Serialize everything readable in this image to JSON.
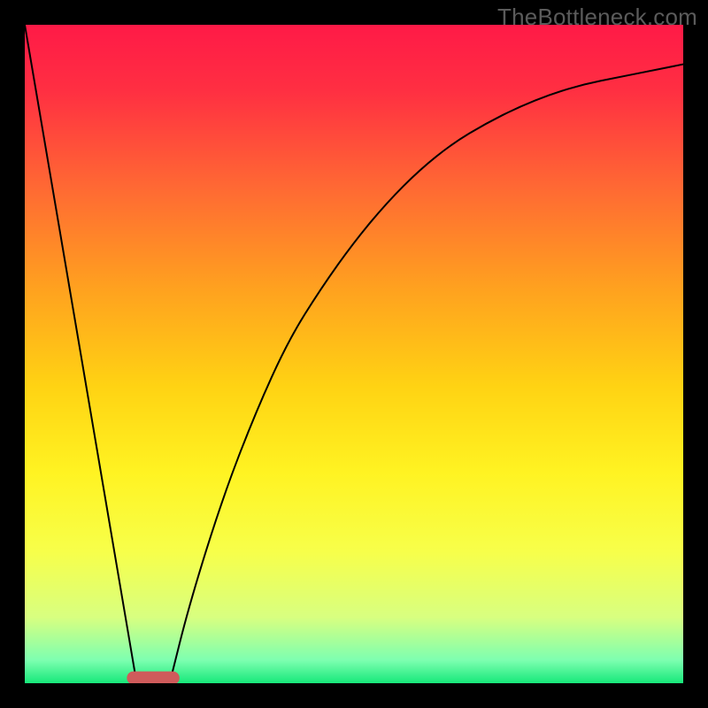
{
  "watermark": "TheBottleneck.com",
  "chart_data": {
    "type": "line",
    "title": "",
    "xlabel": "",
    "ylabel": "",
    "xlim": [
      0,
      100
    ],
    "ylim": [
      0,
      100
    ],
    "grid": false,
    "legend": false,
    "series": [
      {
        "name": "left-falling-line",
        "x": [
          0,
          17
        ],
        "values": [
          100,
          0
        ]
      },
      {
        "name": "right-rising-curve",
        "x": [
          22,
          25,
          30,
          35,
          40,
          45,
          50,
          55,
          60,
          65,
          70,
          75,
          80,
          85,
          90,
          95,
          100
        ],
        "values": [
          0,
          12,
          28,
          41,
          52,
          60,
          67,
          73,
          78,
          82,
          85,
          87.5,
          89.5,
          91,
          92,
          93,
          94
        ]
      }
    ],
    "marker": {
      "name": "bottom-red-pill",
      "cx_pct": 19.5,
      "cy_pct": 99.2,
      "width_pct": 8,
      "height_pct": 2,
      "color": "#cf5b5b"
    },
    "gradient_bands": [
      {
        "stop": 0.0,
        "color": "#ff1a47"
      },
      {
        "stop": 0.1,
        "color": "#ff2f42"
      },
      {
        "stop": 0.25,
        "color": "#ff6a33"
      },
      {
        "stop": 0.4,
        "color": "#ffa11f"
      },
      {
        "stop": 0.55,
        "color": "#ffd313"
      },
      {
        "stop": 0.68,
        "color": "#fff322"
      },
      {
        "stop": 0.8,
        "color": "#f7ff4a"
      },
      {
        "stop": 0.9,
        "color": "#d8ff80"
      },
      {
        "stop": 0.965,
        "color": "#7dffb0"
      },
      {
        "stop": 1.0,
        "color": "#17e87a"
      }
    ]
  }
}
